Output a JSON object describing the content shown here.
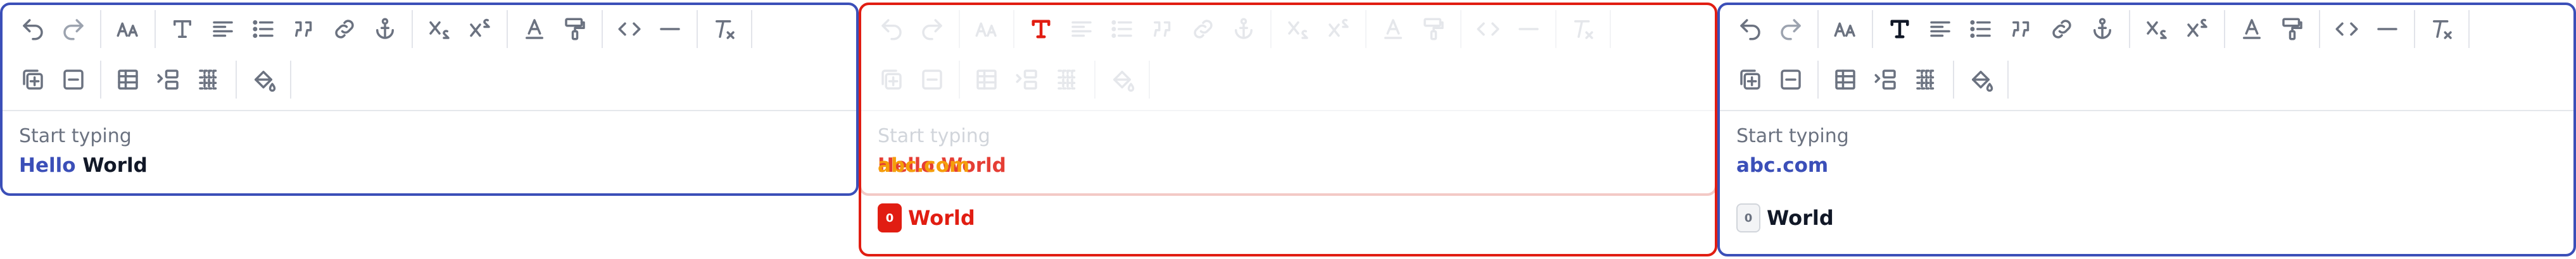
{
  "editor_label": "Start typing",
  "panel_a": {
    "link_word": "Hello",
    "plain_word": "World"
  },
  "panel_b": {
    "ghost_text": "abc.com",
    "ghost_text_overlap": "Hello World",
    "mention_badge": "0",
    "suggestion_word": "World"
  },
  "panel_c": {
    "link_text": "abc.com",
    "mention_badge": "0",
    "suggestion_word": "World"
  },
  "colors": {
    "accent_blue": "#3b4fb8",
    "alert_red": "#e11d12",
    "alert_orange": "#f59e0b",
    "icon_gray": "#6b7280",
    "icon_dark": "#1f2937"
  },
  "toolbar_icons": [
    "undo-icon",
    "redo-icon",
    "font-size-icon",
    "text-style-icon",
    "align-icon",
    "list-icon",
    "quote-icon",
    "link-icon",
    "anchor-icon",
    "subscript-icon",
    "superscript-icon",
    "text-color-icon",
    "paint-icon",
    "code-icon",
    "horizontal-rule-icon",
    "clear-format-icon",
    "add-block-icon",
    "remove-block-icon",
    "table-icon",
    "indent-icon",
    "grid-icon",
    "fill-icon"
  ]
}
